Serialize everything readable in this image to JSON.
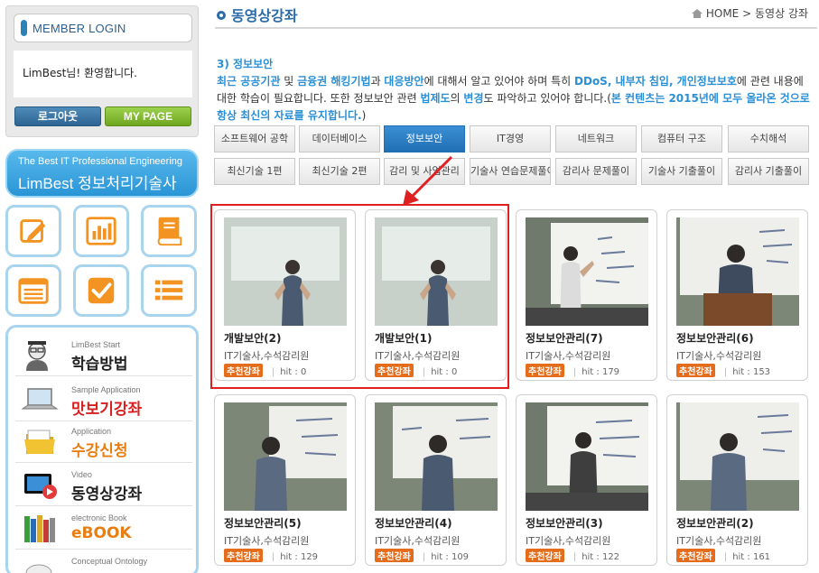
{
  "sidebar": {
    "login_title": "MEMBER LOGIN",
    "welcome": "LimBest님! 환영합니다.",
    "logout_label": "로그아웃",
    "mypage_label": "MY PAGE",
    "banner_sub": "The Best IT Professional Engineering",
    "banner_main": "LimBest 정보처리기술사",
    "tiles": [
      "pencil-icon",
      "chart-icon",
      "book-icon",
      "list-icon",
      "check-icon",
      "menu-list-icon"
    ],
    "menu": [
      {
        "small": "LimBest Start",
        "big": "학습방법",
        "icon": "student-icon",
        "color": "#222222"
      },
      {
        "small": "Sample Application",
        "big": "맛보기강좌",
        "icon": "laptop-icon",
        "color": "#d81f1f"
      },
      {
        "small": "Application",
        "big": "수강신청",
        "icon": "folder-icon",
        "color": "#e87d12"
      },
      {
        "small": "Video",
        "big": "동영상강좌",
        "icon": "video-icon",
        "color": "#222222"
      },
      {
        "small": "electronic Book",
        "big": "eBOOK",
        "icon": "books-icon",
        "color": "#e87d12"
      },
      {
        "small": "Conceptual Ontology",
        "big": "",
        "icon": "ontology-icon",
        "color": "#222222"
      }
    ]
  },
  "header": {
    "title": "동영상강좌",
    "breadcrumb_home": "HOME",
    "breadcrumb_sep": ">",
    "breadcrumb_current": "동영상 강좌"
  },
  "description": {
    "section": "3) 정보보안",
    "p1_a": "최근 공공기관",
    "p1_b": " 및 ",
    "p1_c": "금융권 해킹기법",
    "p1_d": "과 ",
    "p1_e": "대응방안",
    "p1_f": "에 대해서 알고 있어야 하며 특히 ",
    "p1_g": "DDoS, 내부자 침입, 개인정보보호",
    "p1_h": "에 관련 내용에 대한 학습이 필요합니다. 또한 정보보안 관련 ",
    "p1_i": "법제도",
    "p1_j": "의 ",
    "p1_k": "변경",
    "p1_l": "도 파악하고 있어야 합니다.(",
    "p1_m": "본 컨텐츠는 2015년에 모두 올라온 것으로 항상 최신의 자료를 유지합니다.",
    "p1_n": ")"
  },
  "tabs_row1": [
    "소프트웨어 공학",
    "데이터베이스",
    "정보보안",
    "IT경영",
    "네트워크",
    "컴퓨터 구조",
    "수치해석"
  ],
  "tabs_row2": [
    "최신기술 1편",
    "최신기술 2편",
    "감리 및 사업관리",
    "기술사 연습문제풀이",
    "감리사 문제풀이",
    "기술사 기출풀이",
    "감리사 기출풀이"
  ],
  "active_tab": "정보보안",
  "videos": [
    {
      "title": "개발보안(2)",
      "author": "IT기술사,수석감리원",
      "badge": "추천강좌",
      "hit_label": "hit : 0"
    },
    {
      "title": "개발보안(1)",
      "author": "IT기술사,수석감리원",
      "badge": "추천강좌",
      "hit_label": "hit : 0"
    },
    {
      "title": "정보보안관리(7)",
      "author": "IT기술사,수석감리원",
      "badge": "추천강좌",
      "hit_label": "hit : 179"
    },
    {
      "title": "정보보안관리(6)",
      "author": "IT기술사,수석감리원",
      "badge": "추천강좌",
      "hit_label": "hit : 153"
    },
    {
      "title": "정보보안관리(5)",
      "author": "IT기술사,수석감리원",
      "badge": "추천강좌",
      "hit_label": "hit : 129"
    },
    {
      "title": "정보보안관리(4)",
      "author": "IT기술사,수석감리원",
      "badge": "추천강좌",
      "hit_label": "hit : 109"
    },
    {
      "title": "정보보안관리(3)",
      "author": "IT기술사,수석감리원",
      "badge": "추천강좌",
      "hit_label": "hit : 122"
    },
    {
      "title": "정보보안관리(2)",
      "author": "IT기술사,수석감리원",
      "badge": "추천강좌",
      "hit_label": "hit : 161"
    }
  ],
  "colors": {
    "accent": "#2b8fd6",
    "badge": "#e56c1a",
    "highlight": "#e02020",
    "tile_border": "#a8d4ee"
  }
}
